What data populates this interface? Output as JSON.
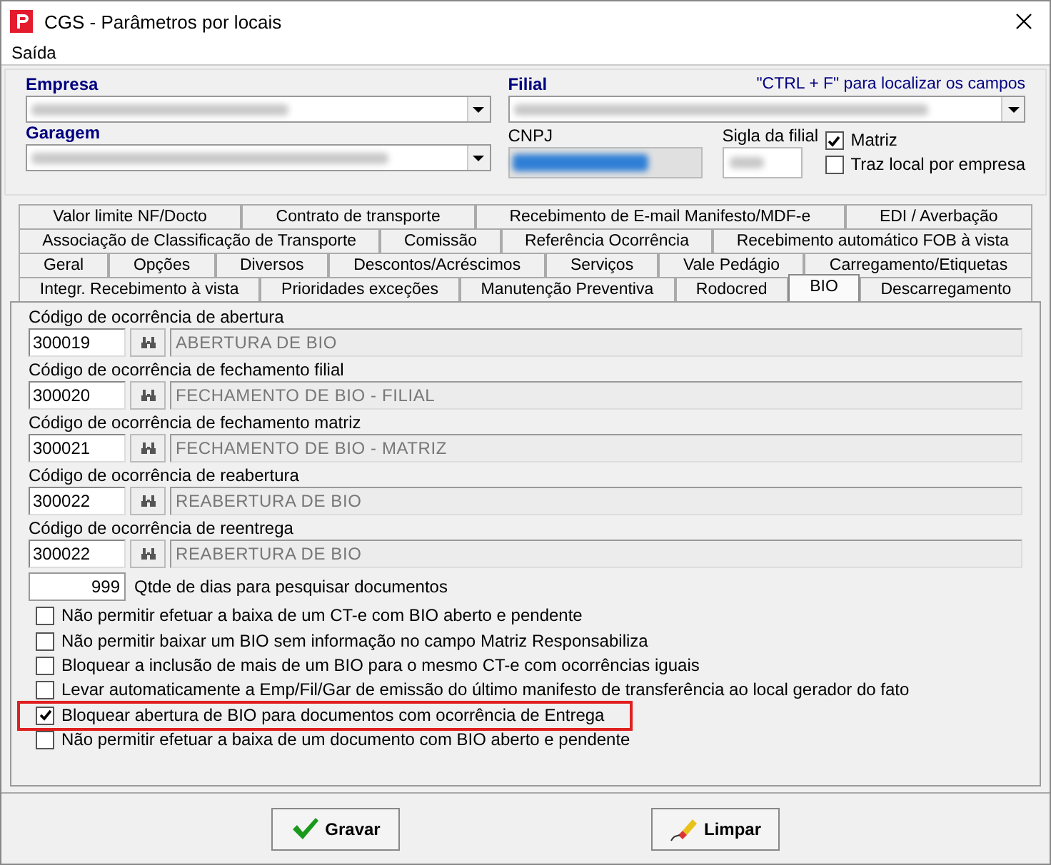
{
  "window": {
    "title": "CGS - Parâmetros por locais"
  },
  "menu": [
    "Saída"
  ],
  "header": {
    "empresa_label": "Empresa",
    "filial_label": "Filial",
    "hint": "\"CTRL + F\" para localizar os campos",
    "garagem_label": "Garagem",
    "cnpj_label": "CNPJ",
    "sigla_label": "Sigla da filial",
    "checks": [
      {
        "label": "Matriz",
        "checked": true
      },
      {
        "label": "Traz local por empresa",
        "checked": false
      }
    ]
  },
  "tab_rows": [
    [
      {
        "label": "Valor limite NF/Docto",
        "selected": false
      },
      {
        "label": "Contrato de transporte",
        "selected": false
      },
      {
        "label": "Recebimento de E-mail Manifesto/MDF-e",
        "selected": false
      },
      {
        "label": "EDI / Averbação",
        "selected": false
      }
    ],
    [
      {
        "label": "Associação de Classificação de Transporte",
        "selected": false
      },
      {
        "label": "Comissão",
        "selected": false
      },
      {
        "label": "Referência Ocorrência",
        "selected": false
      },
      {
        "label": "Recebimento automático FOB à vista",
        "selected": false
      }
    ],
    [
      {
        "label": "Geral",
        "selected": false
      },
      {
        "label": "Opções",
        "selected": false
      },
      {
        "label": "Diversos",
        "selected": false
      },
      {
        "label": "Descontos/Acréscimos",
        "selected": false
      },
      {
        "label": "Serviços",
        "selected": false
      },
      {
        "label": "Vale Pedágio",
        "selected": false
      },
      {
        "label": "Carregamento/Etiquetas",
        "selected": false
      }
    ],
    [
      {
        "label": "Integr. Recebimento à vista",
        "selected": false
      },
      {
        "label": "Prioridades exceções",
        "selected": false
      },
      {
        "label": "Manutenção Preventiva",
        "selected": false
      },
      {
        "label": "Rodocred",
        "selected": false
      },
      {
        "label": "BIO",
        "selected": true
      },
      {
        "label": "Descarregamento",
        "selected": false
      }
    ]
  ],
  "codes": [
    {
      "label": "Código de ocorrência de abertura",
      "code": "300019",
      "description": "ABERTURA DE BIO"
    },
    {
      "label": "Código de ocorrência de fechamento filial",
      "code": "300020",
      "description": "FECHAMENTO DE BIO - FILIAL"
    },
    {
      "label": "Código de ocorrência de fechamento matriz",
      "code": "300021",
      "description": "FECHAMENTO DE BIO - MATRIZ"
    },
    {
      "label": "Código de ocorrência de reabertura",
      "code": "300022",
      "description": "REABERTURA DE BIO"
    },
    {
      "label": "Código de ocorrência de reentrega",
      "code": "300022",
      "description": "REABERTURA DE BIO"
    }
  ],
  "days": {
    "value": "999",
    "label": "Qtde de dias para pesquisar documentos"
  },
  "options": [
    {
      "label": "Não permitir efetuar a baixa de um CT-e com BIO aberto e pendente",
      "checked": false,
      "highlighted": false
    },
    {
      "label": "Não permitir baixar um BIO sem informação no campo Matriz Responsabiliza",
      "checked": false,
      "highlighted": false
    },
    {
      "label": "Bloquear a inclusão de mais de um BIO para o mesmo CT-e com ocorrências iguais",
      "checked": false,
      "highlighted": false
    },
    {
      "label": "Levar automaticamente a Emp/Fil/Gar de emissão do último manifesto de transferência ao local gerador do fato",
      "checked": false,
      "highlighted": false
    },
    {
      "label": "Bloquear abertura de BIO para documentos com ocorrência de Entrega",
      "checked": true,
      "highlighted": true
    },
    {
      "label": "Não permitir efetuar a baixa de um documento com BIO aberto e pendente",
      "checked": false,
      "highlighted": false
    }
  ],
  "buttons": [
    {
      "label": "Gravar",
      "kind": "save"
    },
    {
      "label": "Limpar",
      "kind": "clear"
    }
  ]
}
